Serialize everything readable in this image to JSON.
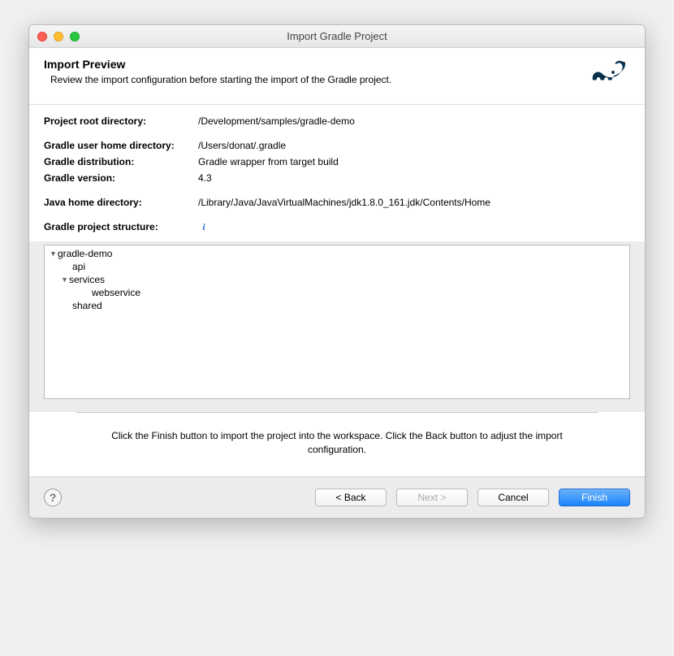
{
  "window": {
    "title": "Import Gradle Project"
  },
  "header": {
    "title": "Import Preview",
    "subtitle": "Review the import configuration before starting the import of the Gradle project."
  },
  "info": {
    "projectRootLabel": "Project root directory:",
    "projectRootValue": "/Development/samples/gradle-demo",
    "userHomeLabel": "Gradle user home directory:",
    "userHomeValue": "/Users/donat/.gradle",
    "distributionLabel": "Gradle distribution:",
    "distributionValue": "Gradle wrapper from target build",
    "versionLabel": "Gradle version:",
    "versionValue": "4.3",
    "javaHomeLabel": "Java home directory:",
    "javaHomeValue": "/Library/Java/JavaVirtualMachines/jdk1.8.0_161.jdk/Contents/Home",
    "structureLabel": "Gradle project structure:"
  },
  "tree": {
    "root": "gradle-demo",
    "api": "api",
    "services": "services",
    "webservice": "webservice",
    "shared": "shared"
  },
  "instruction": "Click the Finish button to import the project into the workspace. Click the Back button to adjust the import configuration.",
  "buttons": {
    "back": "< Back",
    "next": "Next >",
    "cancel": "Cancel",
    "finish": "Finish"
  }
}
